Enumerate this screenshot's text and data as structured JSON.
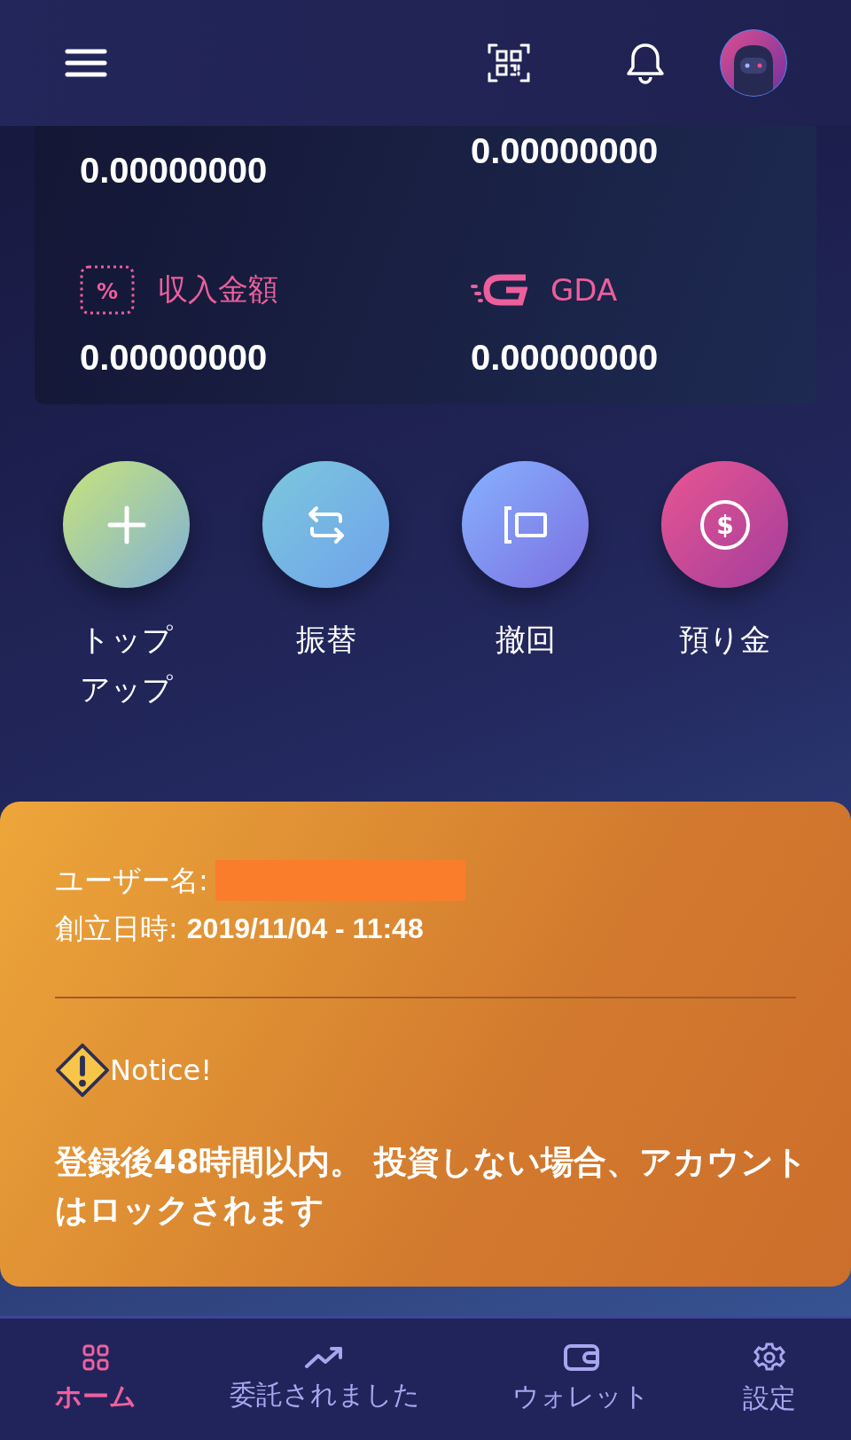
{
  "balances": {
    "top_left_value": "0.00000000",
    "top_right_value": "0.00000000",
    "items": [
      {
        "kind": "percent",
        "icon": "%",
        "label": "収入金額",
        "value": "0.00000000"
      },
      {
        "kind": "gda",
        "label": "GDA",
        "value": "0.00000000"
      }
    ]
  },
  "actions": [
    {
      "kind": "plus",
      "label": "トップアップ"
    },
    {
      "kind": "transfer",
      "label": "振替"
    },
    {
      "kind": "withdraw",
      "label": "撤回"
    },
    {
      "kind": "deposit",
      "icon": "$",
      "label": "預り金"
    }
  ],
  "account": {
    "username_label": "ユーザー名:",
    "created_label": "創立日時:",
    "created_value": "2019/11/04 - 11:48",
    "notice_title": "Notice!",
    "notice_text": "登録後48時間以内。 投資しない場合、アカウントはロックされます"
  },
  "nav": [
    {
      "kind": "home",
      "label": "ホーム",
      "selected": true
    },
    {
      "kind": "trend",
      "label": "委託されました",
      "selected": false
    },
    {
      "kind": "wallet",
      "label": "ウォレット",
      "selected": false
    },
    {
      "kind": "settings",
      "label": "設定",
      "selected": false
    }
  ]
}
